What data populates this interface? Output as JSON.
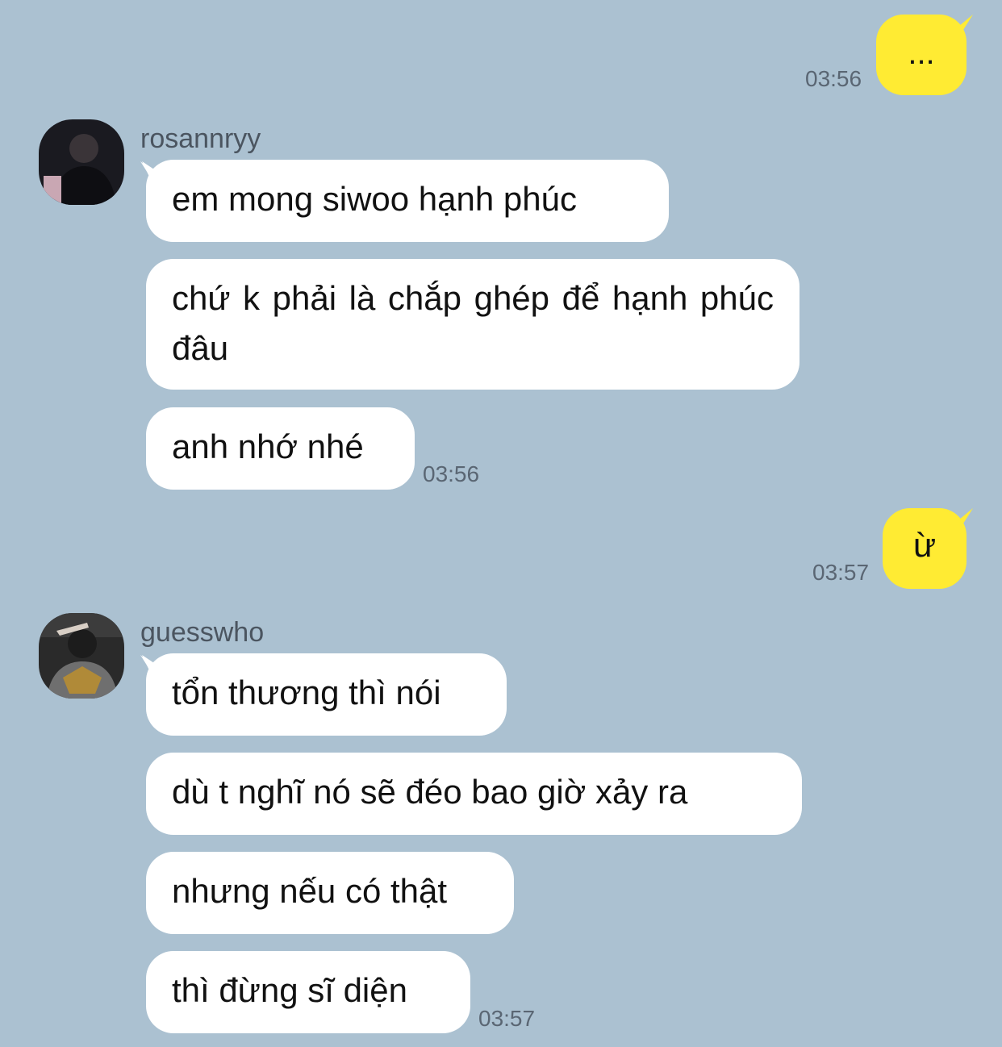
{
  "messages": {
    "me_1": {
      "text": "...",
      "time": "03:56"
    },
    "group_1": {
      "sender": "rosannryy",
      "avatar_icon": "user-avatar-icon",
      "bubbles": [
        "em mong siwoo hạnh phúc",
        "chứ k phải là chắp ghép để hạnh phúc đâu",
        "anh nhớ nhé"
      ],
      "time": "03:56"
    },
    "me_2": {
      "text": "ừ",
      "time": "03:57"
    },
    "group_2": {
      "sender": "guesswho",
      "avatar_icon": "user-avatar-icon",
      "bubbles": [
        "tổn thương thì nói",
        "dù t nghĩ nó sẽ đéo bao giờ xảy ra",
        "nhưng nếu có thật",
        "thì đừng sĩ diện"
      ],
      "time": "03:57"
    }
  },
  "colors": {
    "background": "#abc1d1",
    "my_bubble": "#ffeb33",
    "their_bubble": "#ffffff",
    "timestamp": "#5a6673"
  }
}
